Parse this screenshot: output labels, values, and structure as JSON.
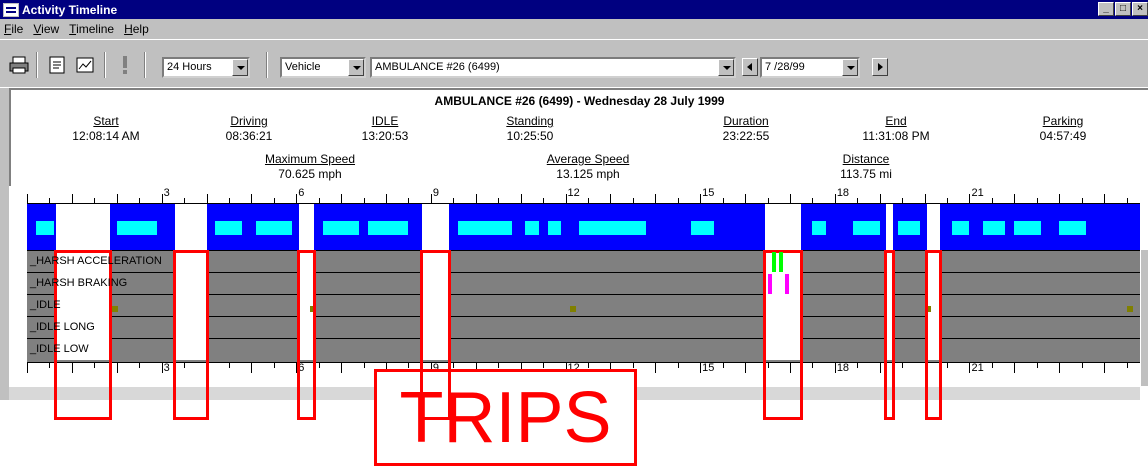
{
  "window": {
    "title": "Activity Timeline",
    "controls": [
      "_",
      "□",
      "×"
    ]
  },
  "menu": {
    "items": [
      "File",
      "View",
      "Timeline",
      "Help"
    ]
  },
  "toolbar": {
    "period": "24 Hours",
    "entity_type": "Vehicle",
    "entity": "AMBULANCE #26 (6499)",
    "date": "7 /28/99"
  },
  "summary": {
    "title": "AMBULANCE #26 (6499) - Wednesday 28 July 1999",
    "stats": [
      {
        "label": "Start",
        "value": "12:08:14 AM"
      },
      {
        "label": "Driving",
        "value": "08:36:21"
      },
      {
        "label": "IDLE",
        "value": "13:20:53"
      },
      {
        "label": "Standing",
        "value": "10:25:50"
      },
      {
        "label": "Duration",
        "value": "23:22:55"
      },
      {
        "label": "End",
        "value": "11:31:08 PM"
      },
      {
        "label": "Parking",
        "value": "04:57:49"
      }
    ],
    "speed": [
      {
        "label": "Maximum Speed",
        "value": "70.625 mph"
      },
      {
        "label": "Average Speed",
        "value": "13.125 mph"
      },
      {
        "label": "Distance",
        "value": "113.75 mi"
      }
    ]
  },
  "timeline": {
    "hours": [
      "3",
      "6",
      "9",
      "12",
      "15",
      "18",
      "21"
    ],
    "hour_domain": [
      0,
      24.8
    ],
    "rows": [
      "_HARSH ACCELERATION",
      "_HARSH BRAKING",
      "_IDLE",
      "_IDLE LONG",
      "_IDLE LOW"
    ],
    "trip_hours": [
      [
        0.65,
        1.85
      ],
      [
        3.3,
        4.0
      ],
      [
        6.05,
        6.4
      ],
      [
        8.8,
        9.4
      ],
      [
        16.45,
        17.25
      ],
      [
        19.15,
        19.3
      ],
      [
        20.05,
        20.35
      ]
    ],
    "idle_hours": [
      [
        0.2,
        0.6
      ],
      [
        2.0,
        2.9
      ],
      [
        4.2,
        4.8
      ],
      [
        5.1,
        5.9
      ],
      [
        6.6,
        7.4
      ],
      [
        7.6,
        8.5
      ],
      [
        9.6,
        10.8
      ],
      [
        11.1,
        11.4
      ],
      [
        11.6,
        11.9
      ],
      [
        12.3,
        13.8
      ],
      [
        14.8,
        15.3
      ],
      [
        17.5,
        17.8
      ],
      [
        18.4,
        19.0
      ],
      [
        19.4,
        19.9
      ],
      [
        20.6,
        21.0
      ],
      [
        21.3,
        21.8
      ],
      [
        22.0,
        22.6
      ],
      [
        23.0,
        23.6
      ]
    ],
    "accel_marks": [
      16.6,
      16.75
    ],
    "braking_marks": [
      16.5,
      16.9
    ]
  },
  "colors": {
    "trip_outline": "#ff0000",
    "idle": "#00ffff",
    "band": "#0000ff",
    "accel": "#00ff00",
    "braking": "#ff00ff",
    "idle_dot": "#808000"
  },
  "callout": {
    "text": "TRIPS"
  }
}
